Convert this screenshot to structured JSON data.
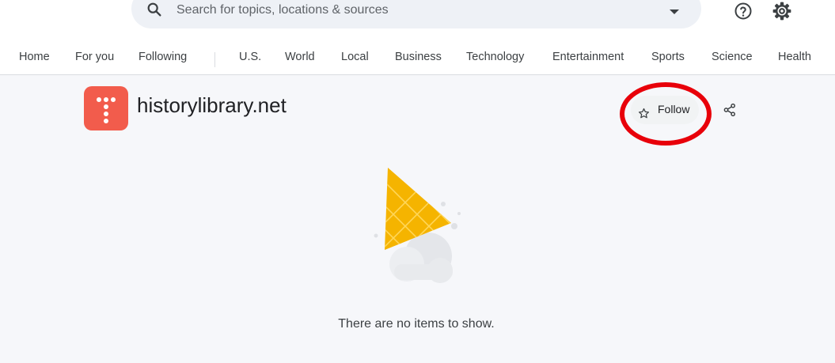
{
  "search": {
    "placeholder": "Search for topics, locations & sources"
  },
  "header": {
    "icons": [
      "search-icon",
      "chevron-down-icon",
      "help-icon",
      "gear-icon"
    ]
  },
  "nav": {
    "items": [
      {
        "label": "Home"
      },
      {
        "label": "For you"
      },
      {
        "label": "Following"
      },
      {
        "label": "U.S."
      },
      {
        "label": "World"
      },
      {
        "label": "Local"
      },
      {
        "label": "Business"
      },
      {
        "label": "Technology"
      },
      {
        "label": "Entertainment"
      },
      {
        "label": "Sports"
      },
      {
        "label": "Science"
      },
      {
        "label": "Health"
      }
    ]
  },
  "source": {
    "title": "historylibrary.net",
    "logo_color": "#f25c4c",
    "follow_label": "Follow",
    "follow_icon": "star-outline-icon",
    "share_icon": "share-icon"
  },
  "annotation": {
    "highlight_color": "#e8000a"
  },
  "main": {
    "empty_message": "There are no items to show."
  }
}
